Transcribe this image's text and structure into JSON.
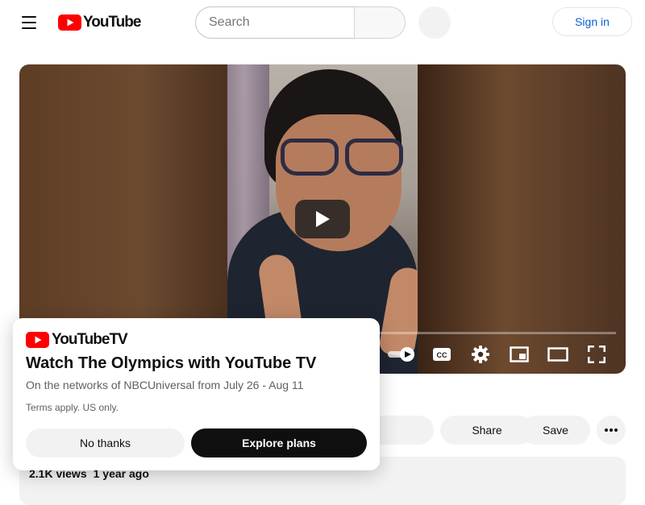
{
  "header": {
    "logo_text": "YouTube",
    "search_placeholder": "Search",
    "signin_label": "Sign in",
    "icons": [
      "menu-icon",
      "search-icon",
      "mic-icon",
      "user-icon"
    ]
  },
  "player": {
    "play_icon": "play-icon",
    "controls_icons": [
      "autoplay-toggle-icon",
      "captions-icon",
      "settings-icon",
      "miniplayer-icon",
      "theater-mode-icon",
      "fullscreen-icon"
    ],
    "captions_label": "CC"
  },
  "actions": {
    "share_label": "Share",
    "save_label": "Save"
  },
  "description": {
    "views": "2.1K views",
    "date": "1 year ago"
  },
  "promo": {
    "brand": "YouTubeTV",
    "title": "Watch The Olympics with YouTube TV",
    "subtitle": "On the networks of NBCUniversal from July 26 - Aug 11",
    "terms": "Terms apply. US only.",
    "decline_label": "No thanks",
    "accept_label": "Explore plans"
  },
  "colors": {
    "youtube_red": "#ff0000",
    "link_blue": "#065fd4",
    "dark": "#0f0f0f",
    "pill_gray": "#f2f2f2"
  }
}
